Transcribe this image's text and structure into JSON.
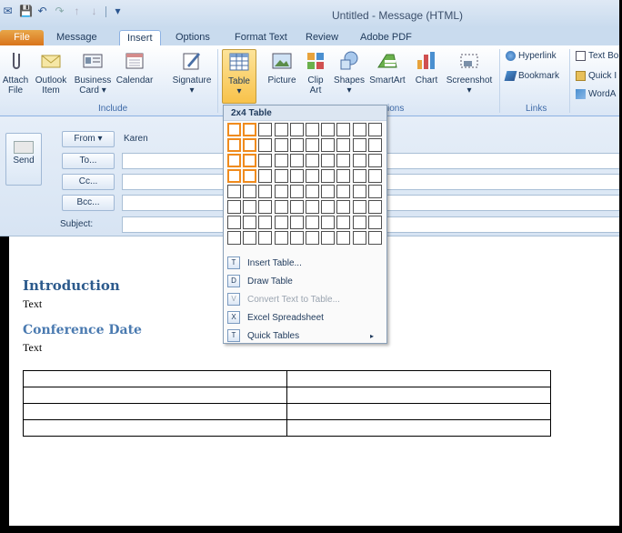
{
  "window": {
    "title": "Untitled - Message (HTML)"
  },
  "qat": {
    "icons": [
      "app-icon",
      "save-icon",
      "undo-icon",
      "redo-icon",
      "up-icon",
      "down-icon",
      "customize-icon"
    ]
  },
  "tabs": [
    {
      "label": "File"
    },
    {
      "label": "Message"
    },
    {
      "label": "Insert"
    },
    {
      "label": "Options"
    },
    {
      "label": "Format Text"
    },
    {
      "label": "Review"
    },
    {
      "label": "Adobe PDF"
    }
  ],
  "ribbon": {
    "include": {
      "label": "Include",
      "buttons": [
        {
          "line1": "Attach",
          "line2": "File"
        },
        {
          "line1": "Outlook",
          "line2": "Item"
        },
        {
          "line1": "Business",
          "line2": "Card ▾"
        },
        {
          "line1": "Calendar",
          "line2": ""
        },
        {
          "line1": "Signature",
          "line2": "▾"
        }
      ]
    },
    "tables": {
      "table": "Table",
      "arrow": "▾"
    },
    "illustrations": {
      "label_suffix": "ions",
      "buttons": [
        {
          "line1": "Picture",
          "line2": ""
        },
        {
          "line1": "Clip",
          "line2": "Art"
        },
        {
          "line1": "Shapes",
          "line2": "▾"
        },
        {
          "line1": "SmartArt",
          "line2": ""
        },
        {
          "line1": "Chart",
          "line2": ""
        },
        {
          "line1": "Screenshot",
          "line2": "▾"
        }
      ]
    },
    "links": {
      "label": "Links",
      "hyperlink": "Hyperlink",
      "bookmark": "Bookmark"
    },
    "text": {
      "textbox": "Text Bo",
      "quick": "Quick I",
      "wordart": "WordA"
    }
  },
  "header": {
    "send": "Send",
    "from_btn": "From ▾",
    "from_value": "Karen",
    "to": "To...",
    "cc": "Cc...",
    "bcc": "Bcc...",
    "subject": "Subject:"
  },
  "body": {
    "heading1": "Introduction",
    "text1": "Text",
    "heading2": "Conference Date",
    "text2": "Text"
  },
  "dropdown": {
    "title": "2x4 Table",
    "items": [
      {
        "label": "Insert Table...",
        "icon": "T"
      },
      {
        "label": "Draw Table",
        "icon": "D"
      },
      {
        "label": "Convert Text to Table...",
        "icon": "V"
      },
      {
        "label": "Excel Spreadsheet",
        "icon": "X"
      },
      {
        "label": "Quick Tables",
        "icon": "T"
      }
    ],
    "submenu_arrow": "▸"
  }
}
